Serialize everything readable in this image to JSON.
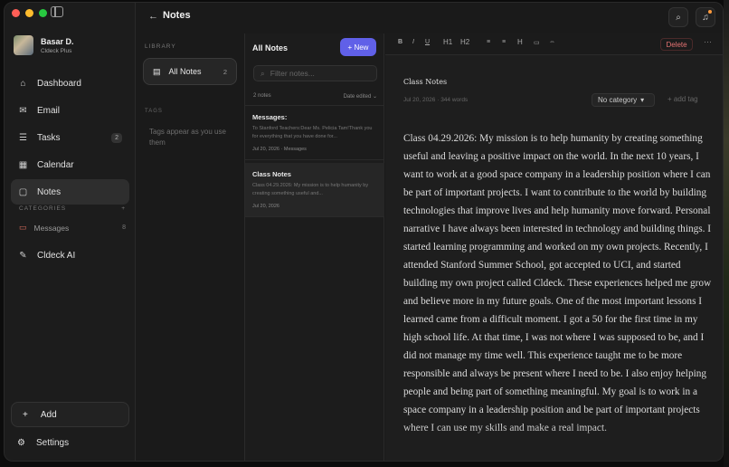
{
  "profile": {
    "name": "Basar D.",
    "plan": "Cldeck Plus"
  },
  "nav": [
    {
      "label": "Dashboard",
      "icon": "home-icon"
    },
    {
      "label": "Email",
      "icon": "mail-icon"
    },
    {
      "label": "Tasks",
      "icon": "list-icon",
      "badge": "2"
    },
    {
      "label": "Calendar",
      "icon": "calendar-icon"
    },
    {
      "label": "Notes",
      "icon": "note-icon",
      "active": true
    }
  ],
  "categories": {
    "header": "CATEGORIES",
    "add": "+",
    "items": [
      {
        "label": "Messages",
        "count": "8"
      }
    ]
  },
  "ai": {
    "label": "Cldeck AI"
  },
  "add": {
    "icon": "+",
    "label": "Add"
  },
  "settings": {
    "label": "Settings"
  },
  "topbar": {
    "title": "Notes"
  },
  "library": {
    "label": "LIBRARY",
    "all_notes": "All Notes",
    "all_count": "2",
    "tags_label": "TAGS",
    "tags_empty": "Tags appear as you use them"
  },
  "notelist": {
    "title": "All Notes",
    "new_label": "+ New",
    "filter_placeholder": "Filter notes...",
    "count": "2 notes",
    "sort": "Date edited",
    "notes": [
      {
        "title": "Messages:",
        "snippet": "To Stanford Teachers:Dear Ms. Pelicia Tam!Thank you for everything that you have done for...",
        "date": "Jul 20, 2026",
        "category": "Messages"
      },
      {
        "title": "Class Notes",
        "snippet": "Class 04.29.2026: My mission is to help humanity by creating something useful and...",
        "date": "Jul 20, 2026",
        "category": ""
      }
    ]
  },
  "toolbar": {
    "bold": "B",
    "italic": "I",
    "underline": "U",
    "h1": "H1",
    "h2": "H2",
    "ul": "≡",
    "ol": "≡",
    "hr": "H",
    "code": "▭",
    "link": "⇔",
    "delete": "Delete",
    "more": "···"
  },
  "doc": {
    "title": "Class Notes",
    "meta": "Jul 20, 2026 · 344 words",
    "category": "No category",
    "add_tag": "+ add tag",
    "body": "Class 04.29.2026: My mission is to help humanity by creating something useful and leaving a positive impact on the world. In the next 10 years, I want to work at a good space company in a leadership position where I can be part of important projects. I want to contribute to the world by building technologies that improve lives and help humanity move forward. Personal narrative I have always been interested in technology and building things. I started learning programming and worked on my own projects. Recently, I attended Stanford Summer School, got accepted to UCI, and started building my own project called Cldeck. These experiences helped me grow and believe more in my future goals. One of the most important lessons I learned came from a difficult moment. I got a 50 for the first time in my high school life. At that time, I was not where I was supposed to be, and I did not manage my time well. This experience taught me to be more responsible and always be present where I need to be. I also enjoy helping people and being part of something meaningful. My goal is to work in a space company in a leadership position and be part of important projects where I can use my skills and make a real impact."
  }
}
